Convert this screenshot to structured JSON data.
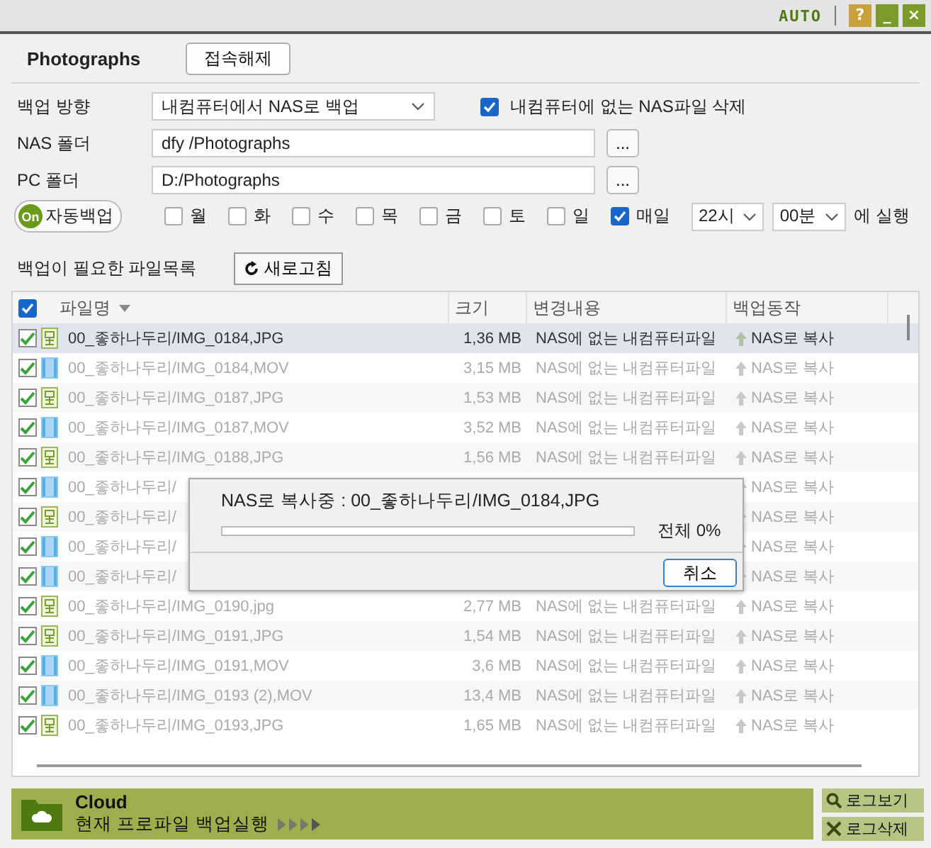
{
  "titlebar": {
    "mode_label": "AUTO",
    "buttons": [
      "?",
      "_",
      "×"
    ]
  },
  "profile": {
    "name": "Photographs",
    "disconnect_button": "접속해제"
  },
  "settings": {
    "direction_label": "백업 방향",
    "direction_value": "내컴퓨터에서 NAS로 백업",
    "delete_option": {
      "label": "내컴퓨터에 없는 NAS파일 삭제",
      "checked": true
    },
    "nas_label": "NAS 폴더",
    "nas_value": "dfy /Photographs",
    "pc_label": "PC 폴더",
    "pc_value": "D:/Photographs",
    "browse_button": "...",
    "auto_toggle": {
      "on_label": "On",
      "label": "자동백업",
      "on": true
    },
    "days": [
      {
        "label": "월",
        "checked": false
      },
      {
        "label": "화",
        "checked": false
      },
      {
        "label": "수",
        "checked": false
      },
      {
        "label": "목",
        "checked": false
      },
      {
        "label": "금",
        "checked": false
      },
      {
        "label": "토",
        "checked": false
      },
      {
        "label": "일",
        "checked": false
      },
      {
        "label": "매일",
        "checked": true
      }
    ],
    "hour": "22시",
    "minute": "00분",
    "run_suffix": "에 실행"
  },
  "list": {
    "title": "백업이 필요한 파일목록",
    "refresh_button": "새로고침",
    "all_checked": true,
    "columns": [
      "파일명",
      "크기",
      "변경내용",
      "백업동작"
    ],
    "rows": [
      {
        "kind": "image",
        "checked": true,
        "selected": true,
        "name": "00_좋하나두리/IMG_0184,JPG",
        "size": "1,36 MB",
        "change": "NAS에 없는 내컴퓨터파일",
        "action": "NAS로 복사"
      },
      {
        "kind": "video",
        "checked": true,
        "selected": false,
        "name": "00_좋하나두리/IMG_0184,MOV",
        "size": "3,15 MB",
        "change": "NAS에 없는 내컴퓨터파일",
        "action": "NAS로 복사"
      },
      {
        "kind": "image",
        "checked": true,
        "selected": false,
        "name": "00_좋하나두리/IMG_0187,JPG",
        "size": "1,53 MB",
        "change": "NAS에 없는 내컴퓨터파일",
        "action": "NAS로 복사"
      },
      {
        "kind": "video",
        "checked": true,
        "selected": false,
        "name": "00_좋하나두리/IMG_0187,MOV",
        "size": "3,52 MB",
        "change": "NAS에 없는 내컴퓨터파일",
        "action": "NAS로 복사"
      },
      {
        "kind": "image",
        "checked": true,
        "selected": false,
        "name": "00_좋하나두리/IMG_0188,JPG",
        "size": "1,56 MB",
        "change": "NAS에 없는 내컴퓨터파일",
        "action": "NAS로 복사"
      },
      {
        "kind": "video",
        "checked": true,
        "selected": false,
        "name": "00_좋하나두리/",
        "action": "NAS로 복사"
      },
      {
        "kind": "image",
        "checked": true,
        "selected": false,
        "name": "00_좋하나두리/",
        "action": "NAS로 복사"
      },
      {
        "kind": "video",
        "checked": true,
        "selected": false,
        "name": "00_좋하나두리/",
        "action": "NAS로 복사"
      },
      {
        "kind": "video",
        "checked": true,
        "selected": false,
        "name": "00_좋하나두리/",
        "action": "NAS로 복사"
      },
      {
        "kind": "image",
        "checked": true,
        "selected": false,
        "name": "00_좋하나두리/IMG_0190,jpg",
        "size": "2,77 MB",
        "change": "NAS에 없는 내컴퓨터파일",
        "action": "NAS로 복사"
      },
      {
        "kind": "image",
        "checked": true,
        "selected": false,
        "name": "00_좋하나두리/IMG_0191,JPG",
        "size": "1,54 MB",
        "change": "NAS에 없는 내컴퓨터파일",
        "action": "NAS로 복사"
      },
      {
        "kind": "video",
        "checked": true,
        "selected": false,
        "name": "00_좋하나두리/IMG_0191,MOV",
        "size": "3,6 MB",
        "change": "NAS에 없는 내컴퓨터파일",
        "action": "NAS로 복사"
      },
      {
        "kind": "video",
        "checked": true,
        "selected": false,
        "name": "00_좋하나두리/IMG_0193 (2),MOV",
        "size": "13,4 MB",
        "change": "NAS에 없는 내컴퓨터파일",
        "action": "NAS로 복사"
      },
      {
        "kind": "image",
        "checked": true,
        "selected": false,
        "name": "00_좋하나두리/IMG_0193,JPG",
        "size": "1,65 MB",
        "change": "NAS에 없는 내컴퓨터파일",
        "action": "NAS로 복사"
      }
    ]
  },
  "progress_dialog": {
    "message": "NAS로 복사중 : 00_좋하나두리/IMG_0184,JPG",
    "level": 0,
    "total": "전체 0%",
    "cancel_button": "취소"
  },
  "footer": {
    "title": "Cloud",
    "subtitle": "현재 프로파일 백업실행",
    "log_view_button": "로그보기",
    "log_delete_button": "로그삭제"
  }
}
